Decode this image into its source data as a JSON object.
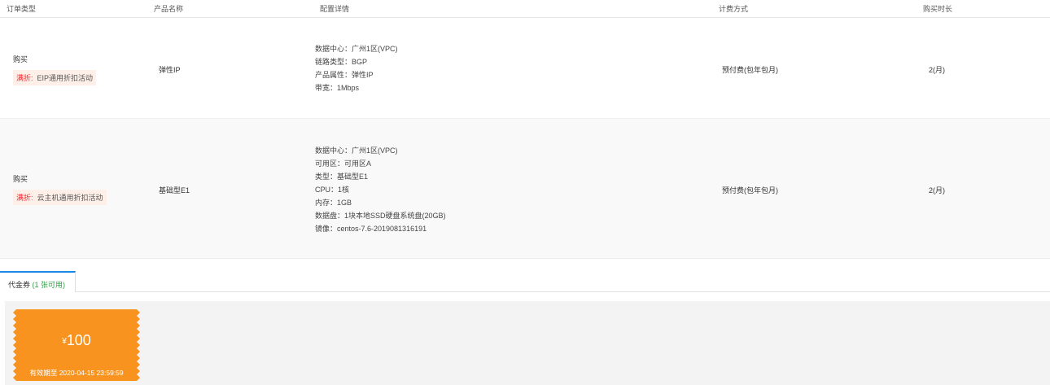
{
  "table": {
    "headers": [
      "订单类型",
      "产品名称",
      "配置详情",
      "计费方式",
      "购买时长"
    ],
    "rows": [
      {
        "order_type": "购买",
        "promo_key": "满折:",
        "promo_value": "EIP通用折扣活动",
        "product": "弹性IP",
        "config": [
          "数据中心：广州1区(VPC)",
          "链路类型：BGP",
          "产品属性：弹性IP",
          "带宽：1Mbps"
        ],
        "billing": "预付费(包年包月)",
        "duration": "2(月)"
      },
      {
        "order_type": "购买",
        "promo_key": "满折:",
        "promo_value": "云主机通用折扣活动",
        "product": "基础型E1",
        "config": [
          "数据中心：广州1区(VPC)",
          "可用区：可用区A",
          "类型：基础型E1",
          "CPU：1核",
          "内存：1GB",
          "数据盘：1块本地SSD硬盘系统盘(20GB)",
          "镜像：centos-7.6-2019081316191"
        ],
        "billing": "预付费(包年包月)",
        "duration": "2(月)"
      }
    ]
  },
  "tabs": {
    "voucher_label": "代金券",
    "voucher_available": "(1 张可用)"
  },
  "coupon": {
    "currency": "¥",
    "amount": "100",
    "expiry": "有效期至 2020-04-15 23:59:59",
    "color": "#f7931e"
  }
}
